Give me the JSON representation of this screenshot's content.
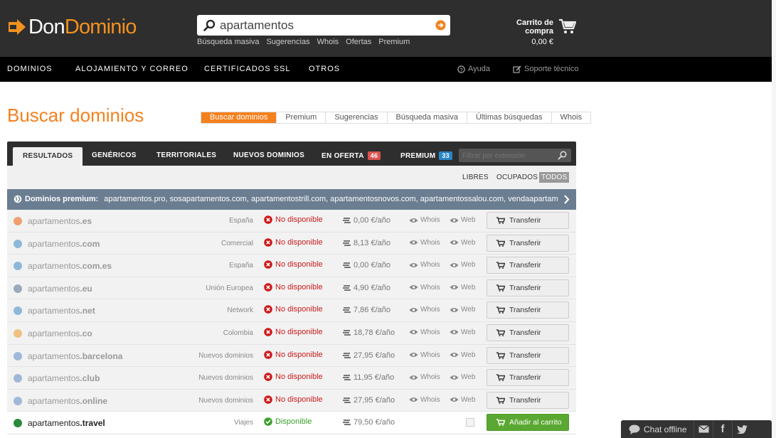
{
  "logo": {
    "part1": "Don",
    "part2": "Dominio"
  },
  "search": {
    "value": "apartamentos",
    "links": [
      "Búsqueda masiva",
      "Sugerencias",
      "Whois",
      "Ofertas",
      "Premium"
    ]
  },
  "cart": {
    "label": "Carrito de compra",
    "total": "0,00 €"
  },
  "nav": {
    "items": [
      "DOMINIOS",
      "ALOJAMIENTO Y CORREO",
      "CERTIFICADOS SSL",
      "OTROS"
    ],
    "help": "Ayuda",
    "support": "Soporte técnico"
  },
  "page": {
    "title": "Buscar dominios",
    "tabs": [
      "Buscar dominios",
      "Premium",
      "Sugerencias",
      "Búsqueda masiva",
      "Últimas búsquedas",
      "Whois"
    ],
    "active_tab": "Buscar dominios"
  },
  "results": {
    "tabs": {
      "resultados": "RESULTADOS",
      "genericos": "GENÉRICOS",
      "territoriales": "TERRITORIALES",
      "nuevos": "NUEVOS DOMINIOS",
      "oferta": "EN OFERTA",
      "oferta_count": "46",
      "premium": "PREMIUM",
      "premium_count": "33"
    },
    "filter_placeholder": "Filtrar por extensión",
    "status_filters": {
      "libres": "LIBRES",
      "ocupados": "OCUPADOS",
      "todos": "TODOS"
    },
    "premium_bar": {
      "label": "Dominios premium:",
      "domains": "apartamentos.pro,  sosapartamentos.com,  apartamentostrill.com,  apartamentosnovos.com,  apartamentossalou.com,  vendaapartam..."
    },
    "whois_label": "Whois",
    "web_label": "Web",
    "rows": [
      {
        "name": "apartamentos",
        "ext": ".es",
        "category": "España",
        "status": "No disponible",
        "price": "0,00 €/año",
        "action": "Transferir",
        "available": false,
        "dot_color": "#f0a070"
      },
      {
        "name": "apartamentos",
        "ext": ".com",
        "category": "Comercial",
        "status": "No disponible",
        "price": "8,13 €/año",
        "action": "Transferir",
        "available": false,
        "dot_color": "#8fb8d8"
      },
      {
        "name": "apartamentos",
        "ext": ".com.es",
        "category": "España",
        "status": "No disponible",
        "price": "0,00 €/año",
        "action": "Transferir",
        "available": false,
        "dot_color": "#8fb8d8"
      },
      {
        "name": "apartamentos",
        "ext": ".eu",
        "category": "Unión Europea",
        "status": "No disponible",
        "price": "4,90 €/año",
        "action": "Transferir",
        "available": false,
        "dot_color": "#9aaabb"
      },
      {
        "name": "apartamentos",
        "ext": ".net",
        "category": "Network",
        "status": "No disponible",
        "price": "7,86 €/año",
        "action": "Transferir",
        "available": false,
        "dot_color": "#8fb8d8"
      },
      {
        "name": "apartamentos",
        "ext": ".co",
        "category": "Colombia",
        "status": "No disponible",
        "price": "18,78 €/año",
        "action": "Transferir",
        "available": false,
        "dot_color": "#f0c080"
      },
      {
        "name": "apartamentos",
        "ext": ".barcelona",
        "category": "Nuevos dominios",
        "status": "No disponible",
        "price": "27,95 €/año",
        "action": "Transferir",
        "available": false,
        "dot_color": "#a0b8d8"
      },
      {
        "name": "apartamentos",
        "ext": ".club",
        "category": "Nuevos dominios",
        "status": "No disponible",
        "price": "11,95 €/año",
        "action": "Transferir",
        "available": false,
        "dot_color": "#a0b8d8"
      },
      {
        "name": "apartamentos",
        "ext": ".online",
        "category": "Nuevos dominios",
        "status": "No disponible",
        "price": "27,95 €/año",
        "action": "Transferir",
        "available": false,
        "dot_color": "#a0b8d8"
      },
      {
        "name": "apartamentos",
        "ext": ".travel",
        "category": "Viajes",
        "status": "Disponible",
        "price": "79,50 €/año",
        "action": "Añadir al carrito",
        "available": true,
        "dot_color": "#2a8a3a"
      }
    ]
  },
  "chat": {
    "label": "Chat offline"
  },
  "colors": {
    "accent": "#f4811e",
    "header": "#2e2e2e",
    "unavailable": "#cc1a1a",
    "available": "#38a02a",
    "add_button": "#5aa832"
  }
}
